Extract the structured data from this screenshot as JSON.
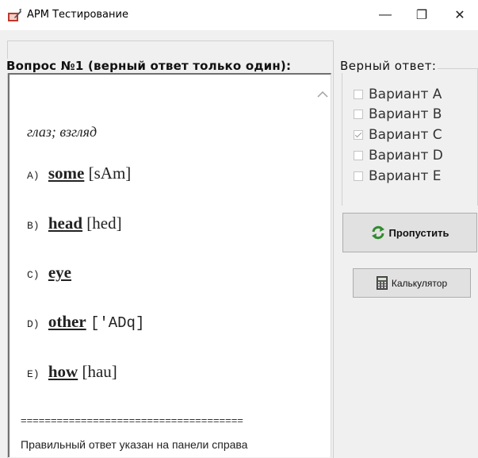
{
  "window": {
    "title": "АРМ Тестирование",
    "minimize": "—",
    "maximize": "❐",
    "close": "✕"
  },
  "question": {
    "legend": "Вопрос №1 (верный ответ только один):",
    "word": "глаз; взгляд",
    "options": [
      {
        "letter": "A)",
        "word": "some",
        "transcription": "[sAm]"
      },
      {
        "letter": "B)",
        "word": "head",
        "transcription": "[hed]"
      },
      {
        "letter": "C)",
        "word": "eye",
        "transcription": ""
      },
      {
        "letter": "D)",
        "word": "other",
        "transcription": "['ADq]"
      },
      {
        "letter": "E)",
        "word": "how",
        "transcription": "[hau]"
      }
    ],
    "separator": "=====================================",
    "note": "Правильный ответ указан на панели справа",
    "scroll_icon": "scroll-up-arrow"
  },
  "answer": {
    "legend": "Верный ответ:",
    "variants": [
      {
        "label": "Вариант A",
        "checked": false
      },
      {
        "label": "Вариант B",
        "checked": false
      },
      {
        "label": "Вариант C",
        "checked": true
      },
      {
        "label": "Вариант D",
        "checked": false
      },
      {
        "label": "Вариант E",
        "checked": false
      }
    ]
  },
  "buttons": {
    "skip_label": "Пропустить",
    "skip_icon": "refresh-icon",
    "calc_label": "Калькулятор",
    "calc_icon": "calculator-icon"
  },
  "colors": {
    "refresh_green": "#2e8b2e",
    "panel_bg": "#ffffff",
    "window_bg": "#f0f0f0"
  }
}
